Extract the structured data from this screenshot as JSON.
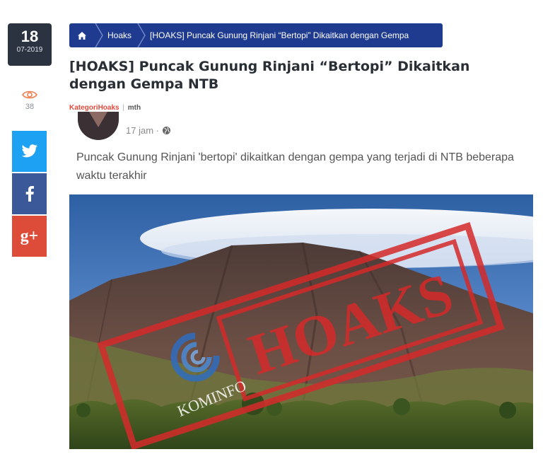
{
  "date": {
    "day": "18",
    "month": "07-2019"
  },
  "views": {
    "icon": "eye-icon",
    "count": "38"
  },
  "share": {
    "twitter_icon": "twitter-icon",
    "facebook_icon": "facebook-icon",
    "gplus_label": "g+"
  },
  "breadcrumb": {
    "home_icon": "home-icon",
    "category": "Hoaks",
    "current": "[HOAKS] Puncak Gunung Rinjani “Bertopi” Dikaitkan dengan Gempa"
  },
  "article": {
    "title": "[HOAKS] Puncak Gunung Rinjani “Bertopi” Dikaitkan dengan Gempa NTB",
    "meta": {
      "category_label": "Kategori",
      "category_value": "Hoaks",
      "separator": "|",
      "author": "mth"
    }
  },
  "embedded_post": {
    "time": "17 jam",
    "post_text": "Puncak Gunung Rinjani 'bertopi' dikaitkan dengan gempa yang terjadi di NTB beberapa waktu terakhir"
  },
  "image": {
    "stamp_text": "HOAKS",
    "logo_text": "KOMINFO"
  },
  "colors": {
    "breadcrumb_bg": "#1f3b8f",
    "date_bg": "#2b3340",
    "accent_red": "#e2493b",
    "twitter": "#1da1f2",
    "facebook": "#3b5998",
    "gplus": "#dd4b39",
    "eye": "#f07d4f"
  }
}
